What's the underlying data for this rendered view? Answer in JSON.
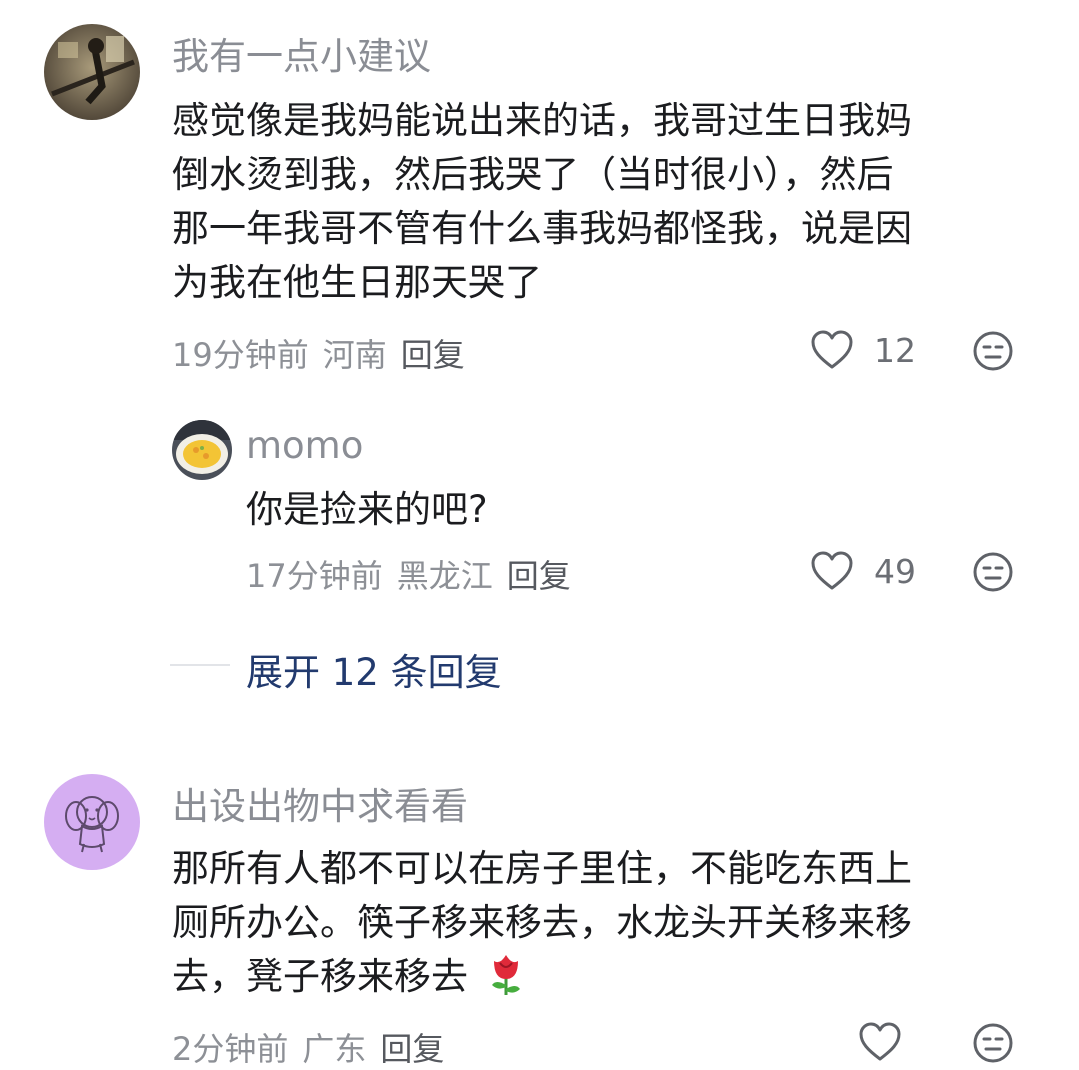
{
  "comments": [
    {
      "username": "我有一点小建议",
      "lines": [
        "感觉像是我妈能说出来的话，我哥过生日我妈",
        "倒水烫到我，然后我哭了（当时很小），然后",
        "那一年我哥不管有什么事我妈都怪我，说是因",
        "为我在他生日那天哭了"
      ],
      "time": "19分钟前",
      "location": "河南",
      "reply_label": "回复",
      "likes": "12"
    },
    {
      "username": "出设出物中求看看",
      "lines": [
        "那所有人都不可以在房子里住，不能吃东西上",
        "厕所办公。筷子移来移去，水龙头开关移来移",
        "去，凳子移来移去"
      ],
      "time": "2分钟前",
      "location": "广东",
      "reply_label": "回复"
    }
  ],
  "reply": {
    "username": "momo",
    "text": "你是捡来的吧?",
    "time": "17分钟前",
    "location": "黑龙江",
    "reply_label": "回复",
    "likes": "49"
  },
  "expand_label": "展开 12 条回复",
  "icons": {
    "like": "heart-outline-icon",
    "dislike": "neutral-face-icon",
    "emoji": "rose-emoji"
  },
  "colors": {
    "username": "#8a8d94",
    "text": "#1b1c1f",
    "link": "#223a6e",
    "avatar_purple": "#d5aef2"
  }
}
